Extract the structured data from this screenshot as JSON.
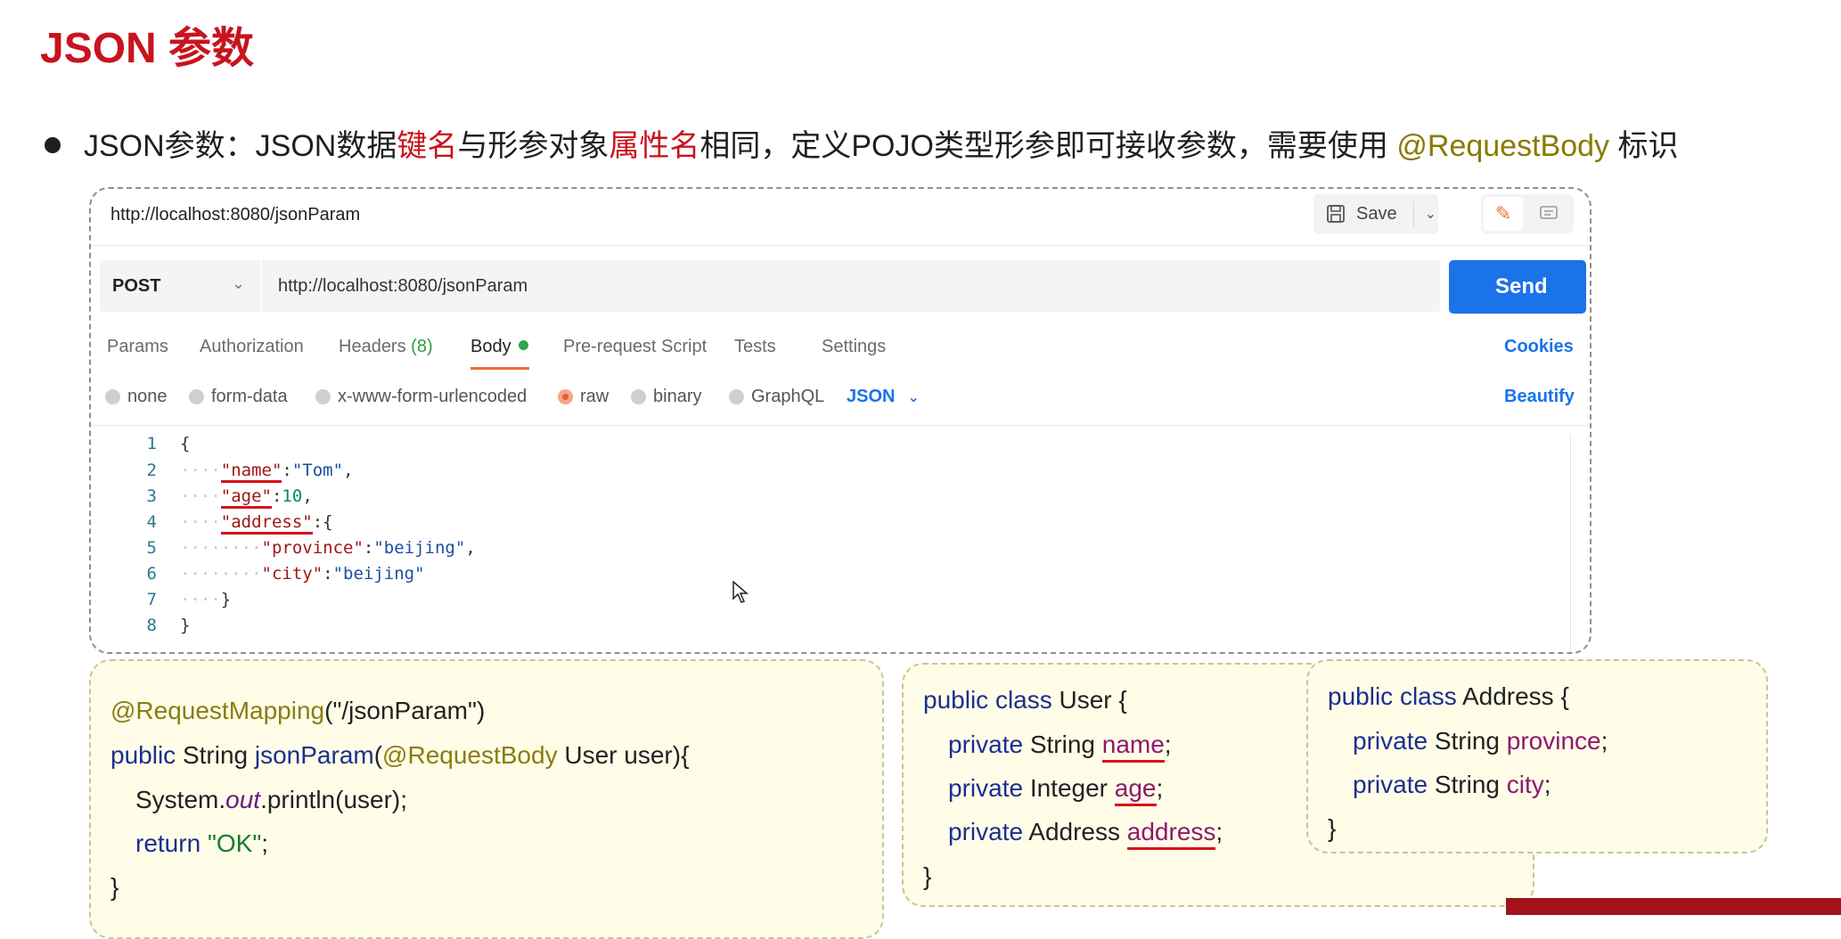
{
  "slide": {
    "title": "JSON 参数",
    "bullet": {
      "part1": "JSON参数：JSON数据",
      "highlight1": "键名",
      "part2": "与形参对象",
      "highlight2": "属性名",
      "part3": "相同，定义POJO类型形参即可接收参数，需要使用 ",
      "highlight3": "@RequestBody",
      "part4": " 标识"
    }
  },
  "postman": {
    "tab_url": "http://localhost:8080/jsonParam",
    "save_label": "Save",
    "method": "POST",
    "request_url": "http://localhost:8080/jsonParam",
    "send_label": "Send",
    "tabs": [
      {
        "label": "Params"
      },
      {
        "label": "Authorization"
      },
      {
        "label": "Headers",
        "count": "(8)"
      },
      {
        "label": "Body"
      },
      {
        "label": "Pre-request Script"
      },
      {
        "label": "Tests"
      },
      {
        "label": "Settings"
      }
    ],
    "cookies_label": "Cookies",
    "body_types": [
      {
        "label": "none"
      },
      {
        "label": "form-data"
      },
      {
        "label": "x-www-form-urlencoded"
      },
      {
        "label": "raw"
      },
      {
        "label": "binary"
      },
      {
        "label": "GraphQL"
      }
    ],
    "format_label": "JSON",
    "beautify_label": "Beautify",
    "line_numbers": [
      "1",
      "2",
      "3",
      "4",
      "5",
      "6",
      "7",
      "8"
    ],
    "json": {
      "brace_open": "{",
      "brace_close": "}",
      "k_name": "\"name\"",
      "v_name": "\"Tom\"",
      "k_age": "\"age\"",
      "v_age": "10",
      "k_address": "\"address\"",
      "k_province": "\"province\"",
      "v_province": "\"beijing\"",
      "k_city": "\"city\"",
      "v_city": "\"beijing\""
    }
  },
  "controller_card": {
    "l1_ann": "@RequestMapping",
    "l1_rest": "(\"/jsonParam\")",
    "l2_kw": "public",
    "l2_type": " String ",
    "l2_method": "jsonParam",
    "l2_open": "(",
    "l2_ann": "@RequestBody",
    "l2_rest": " User user){",
    "l3_a": "System.",
    "l3_out": "out",
    "l3_b": ".println(user);",
    "l4_kw": "return ",
    "l4_str": "\"OK\"",
    "l4_end": ";",
    "l5": "}"
  },
  "user_card": {
    "l1_kw": "public class",
    "l1_rest": " User {",
    "f1_kw": "private",
    "f1_type": " String ",
    "f1_name": "name",
    "f2_kw": "private",
    "f2_type": " Integer ",
    "f2_name": "age",
    "f3_kw": "private",
    "f3_type": " Address ",
    "f3_name": "address",
    "semi": ";",
    "close": "}"
  },
  "address_card": {
    "l1_kw": "public class",
    "l1_rest": " Address {",
    "f1_kw": "private",
    "f1_type": " String ",
    "f1_name": "province",
    "f2_kw": "private",
    "f2_type": " String ",
    "f2_name": "city",
    "semi": ";",
    "close": "}"
  },
  "colors": {
    "accent_red": "#c8141e",
    "send_blue": "#1a73e8",
    "annotation_olive": "#8a7a00"
  }
}
